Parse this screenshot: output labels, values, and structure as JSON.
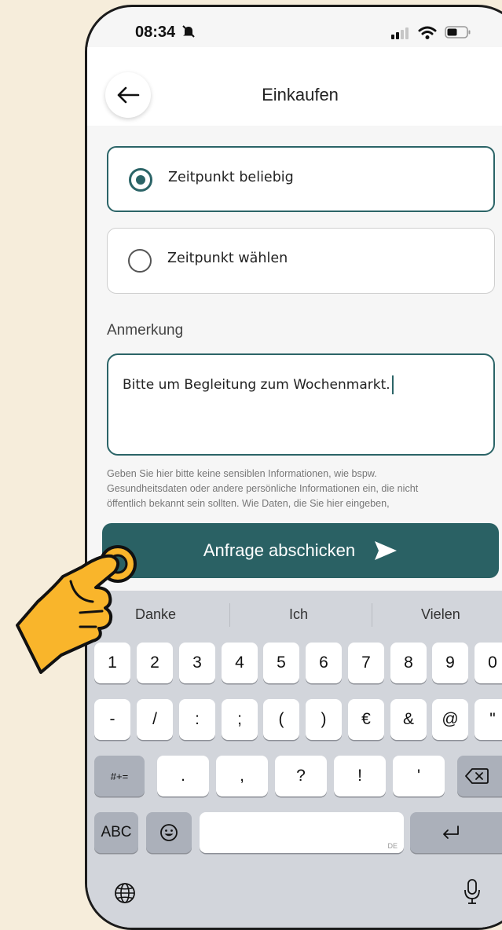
{
  "status": {
    "time": "08:34"
  },
  "header": {
    "title": "Einkaufen"
  },
  "options": [
    {
      "label": "Zeitpunkt beliebig",
      "selected": true
    },
    {
      "label": "Zeitpunkt wählen",
      "selected": false
    }
  ],
  "note": {
    "label": "Anmerkung",
    "value": "Bitte um Begleitung zum Wochenmarkt.",
    "hint_lines": [
      "Geben Sie hier bitte keine sensiblen Informationen, wie bspw.",
      "Gesundheitsdaten oder andere persönliche Informationen ein, die nicht",
      "öffentlich bekannt sein sollten. Wie Daten, die Sie hier eingeben,"
    ]
  },
  "submit_label": "Anfrage abschicken",
  "keyboard": {
    "suggestions": [
      "Danke",
      "Ich",
      "Vielen"
    ],
    "row1": [
      "1",
      "2",
      "3",
      "4",
      "5",
      "6",
      "7",
      "8",
      "9",
      "0"
    ],
    "row2": [
      "-",
      "/",
      ":",
      ";",
      "(",
      ")",
      "€",
      "&",
      "@",
      "\""
    ],
    "row3": {
      "left": "#+=",
      "keys": [
        ".",
        ",",
        "?",
        "!",
        "'"
      ]
    },
    "abc": "ABC",
    "space_hint": "DE"
  },
  "colors": {
    "accent": "#2a6164",
    "background": "#f6eddb",
    "hand": "#f9b52b"
  }
}
